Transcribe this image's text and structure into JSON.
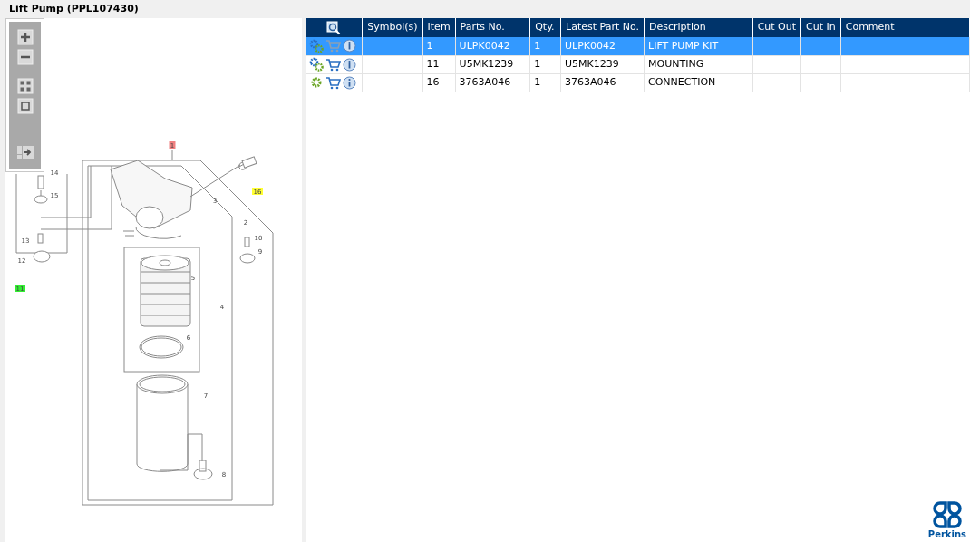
{
  "window": {
    "title": "Lift Pump (PPL107430)"
  },
  "table": {
    "columns": [
      "Symbol(s)",
      "Item",
      "Parts No.",
      "Qty.",
      "Latest Part No.",
      "Description",
      "Cut Out",
      "Cut In",
      "Comment"
    ],
    "rows": [
      {
        "selected": true,
        "kind": "pair",
        "item": "1",
        "parts_no": "ULPK0042",
        "qty": "1",
        "latest_part_no": "ULPK0042",
        "description": "LIFT PUMP KIT"
      },
      {
        "selected": false,
        "kind": "pair",
        "item": "11",
        "parts_no": "U5MK1239",
        "qty": "1",
        "latest_part_no": "U5MK1239",
        "description": "MOUNTING"
      },
      {
        "selected": false,
        "kind": "single",
        "item": "16",
        "parts_no": "3763A046",
        "qty": "1",
        "latest_part_no": "3763A046",
        "description": "CONNECTION"
      }
    ]
  },
  "diagram": {
    "callouts": [
      {
        "label": "1",
        "color": "#f08080"
      },
      {
        "label": "16",
        "color": "#ffff33"
      },
      {
        "label": "11",
        "color": "#33ee33"
      },
      {
        "label": "2"
      },
      {
        "label": "3"
      },
      {
        "label": "4"
      },
      {
        "label": "5"
      },
      {
        "label": "6"
      },
      {
        "label": "7"
      },
      {
        "label": "8"
      },
      {
        "label": "10"
      },
      {
        "label": "9"
      },
      {
        "label": "12"
      },
      {
        "label": "13"
      },
      {
        "label": "14"
      },
      {
        "label": "15"
      }
    ]
  },
  "brand": {
    "name": "Perkins"
  }
}
